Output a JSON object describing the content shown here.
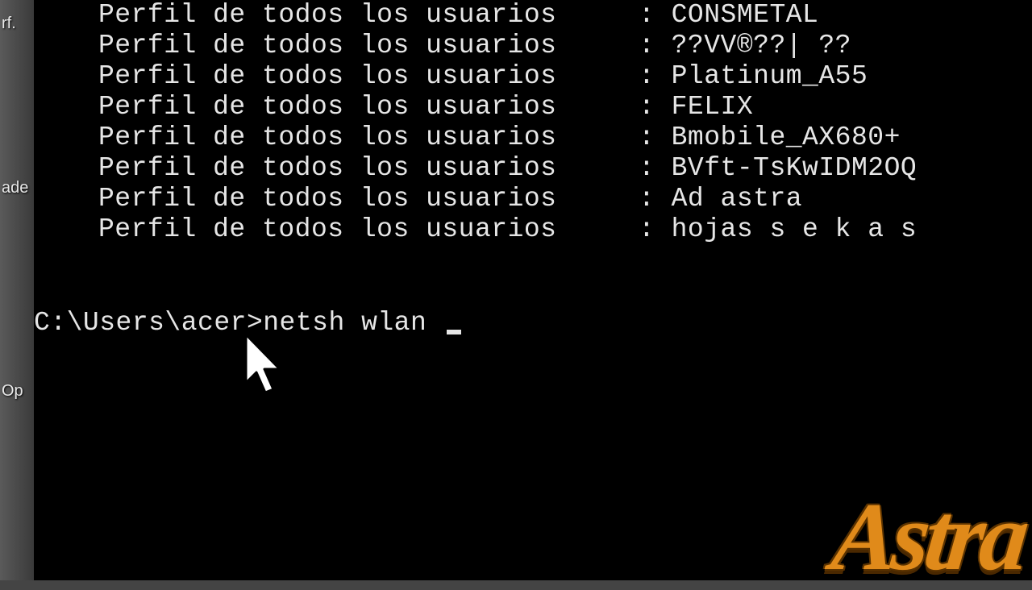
{
  "desktop": {
    "label_top": "rf.",
    "label_mid": "ade",
    "label_bottom": "Op"
  },
  "terminal": {
    "profile_prefix": "Perfil de todos los usuarios     : ",
    "profiles": [
      "CONSMETAL",
      "??VV®??| ??",
      "Platinum_A55",
      "FELIX",
      "Bmobile_AX680+",
      "BVft-TsKwIDM2OQ",
      "Ad astra",
      "hojas s e k a s"
    ],
    "prompt": "C:\\Users\\acer>",
    "command": "netsh wlan "
  },
  "watermark": {
    "text": "Astra"
  }
}
